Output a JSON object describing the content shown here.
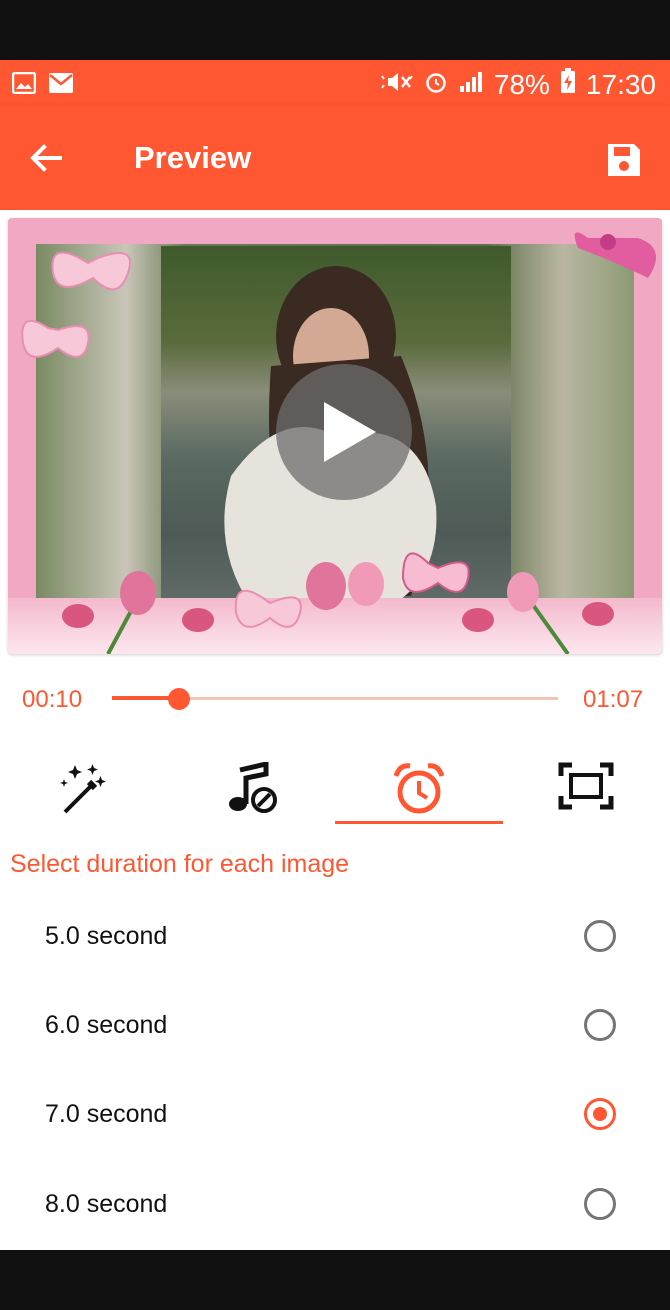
{
  "status_bar": {
    "battery": "78%",
    "time": "17:30",
    "icons": [
      "gallery-icon",
      "mail-icon",
      "mute-icon",
      "alarm-icon",
      "signal-icon",
      "battery-charging-icon"
    ]
  },
  "app_bar": {
    "title": "Preview",
    "back_icon": "arrow-back-icon",
    "save_icon": "save-icon"
  },
  "player": {
    "current_time": "00:10",
    "total_time": "01:07",
    "progress": 0.15
  },
  "tools": [
    {
      "name": "effects",
      "icon": "magic-wand-icon",
      "selected": false
    },
    {
      "name": "music",
      "icon": "music-note-icon",
      "selected": false
    },
    {
      "name": "duration",
      "icon": "alarm-clock-icon",
      "selected": true
    },
    {
      "name": "frame",
      "icon": "frame-icon",
      "selected": false
    }
  ],
  "duration": {
    "label": "Select duration for each image",
    "options": [
      {
        "label": "5.0 second",
        "selected": false
      },
      {
        "label": "6.0 second",
        "selected": false
      },
      {
        "label": "7.0 second",
        "selected": true
      },
      {
        "label": "8.0 second",
        "selected": false
      }
    ]
  },
  "colors": {
    "accent": "#fe5732",
    "frame_pink": "#f1a9c3"
  }
}
